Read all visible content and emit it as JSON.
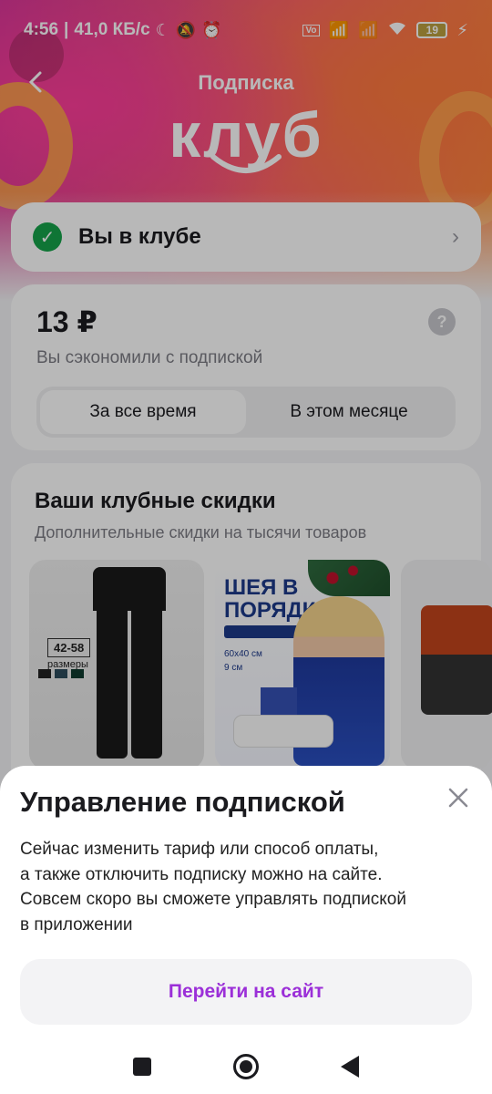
{
  "status_bar": {
    "time": "4:56",
    "network_speed": "41,0 КБ/с",
    "battery": "19",
    "icons": [
      "moon-icon",
      "mute-icon",
      "alarm-icon",
      "volte-icon",
      "signal-icon",
      "wifi-icon",
      "battery-icon",
      "charging-icon"
    ]
  },
  "header": {
    "subtitle": "Подписка",
    "logo_text": "клуб"
  },
  "club_status": {
    "label": "Вы в клубе"
  },
  "savings": {
    "amount": "13 ₽",
    "description": "Вы сэкономили с подпиской",
    "tabs": [
      {
        "label": "За все время",
        "active": true
      },
      {
        "label": "В этом месяце",
        "active": false
      }
    ]
  },
  "discounts": {
    "title": "Ваши клубные скидки",
    "subtitle": "Дополнительные скидки на тысячи товаров",
    "products": [
      {
        "size_label": "42-58",
        "size_caption": "размеры"
      },
      {
        "headline_line1": "ШЕЯ В",
        "headline_line2": "ПОРЯДКЕ",
        "spec1": "60x40 см",
        "spec2": "9 см"
      },
      {}
    ]
  },
  "sheet": {
    "title": "Управление подпиской",
    "body_line1": "Сейчас изменить тариф или способ оплаты,",
    "body_line2": "а также отключить подписку можно на сайте.",
    "body_line3": "Совсем скоро вы сможете управлять подпиской",
    "body_line4": "в приложении",
    "cta_label": "Перейти на сайт"
  },
  "colors": {
    "accent": "#9b2fd8",
    "success": "#16a34a"
  }
}
